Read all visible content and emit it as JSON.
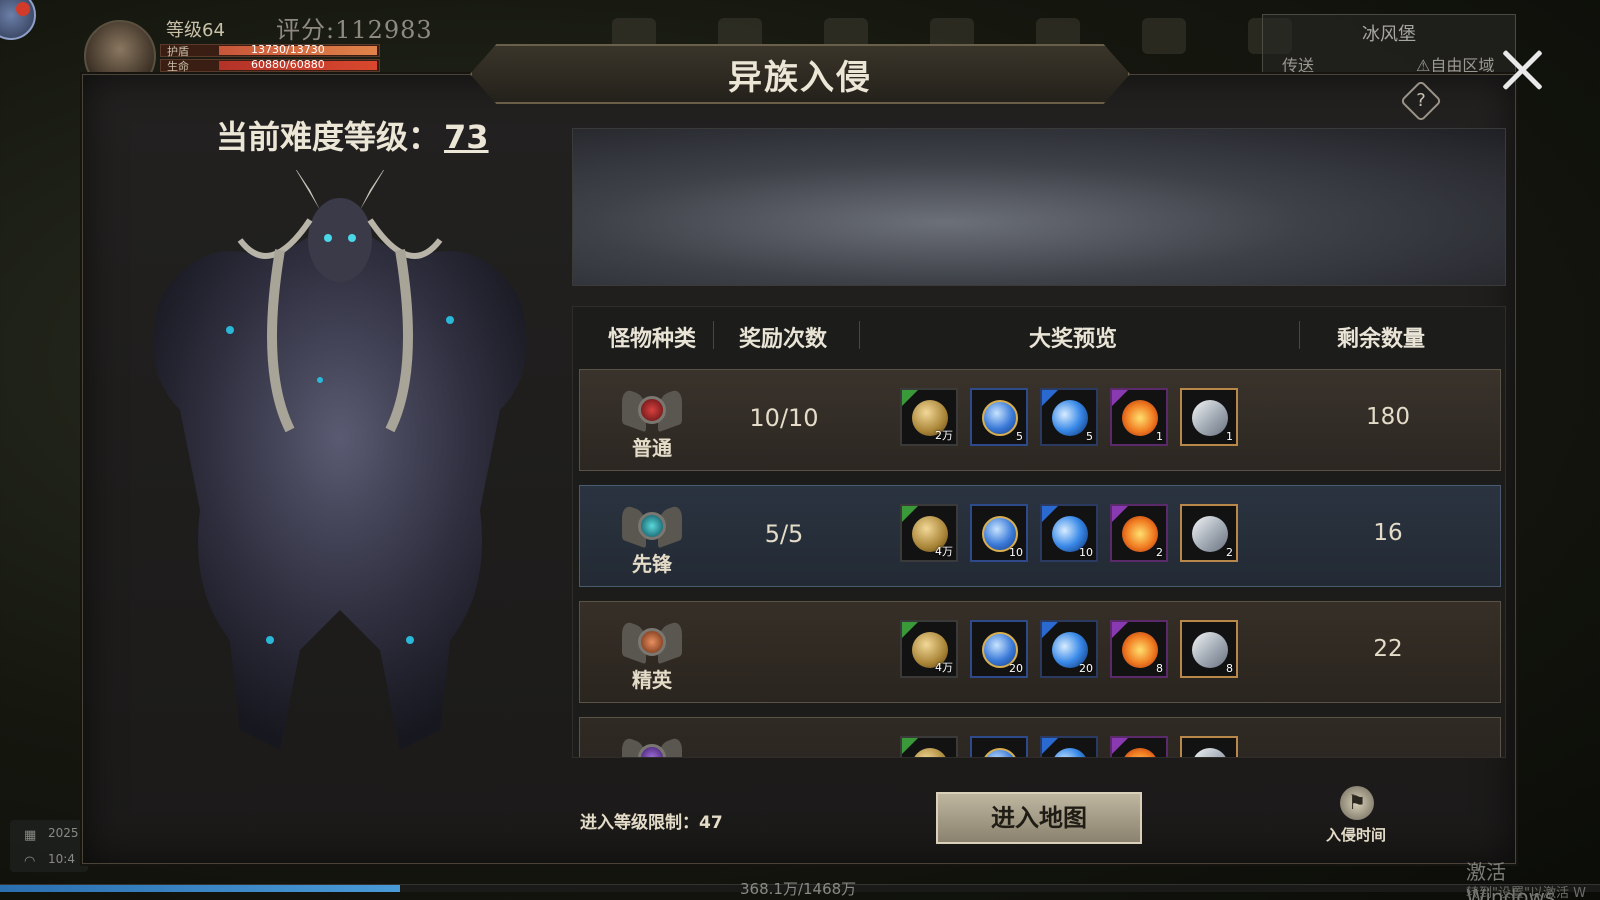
{
  "hud": {
    "level": "等级64",
    "score": "评分:112983",
    "shield_label": "护盾",
    "shield_value": "13730/13730",
    "hp_label": "生命",
    "hp_value": "60880/60880",
    "map_name": "冰风堡",
    "teleport": "传送",
    "zone": "⚠自由区域",
    "date": "2025",
    "time": "10:4",
    "exp_text": "368.1万/1468万",
    "exp_progress": 0.25,
    "windows_watermark": "激活 Windows",
    "windows_watermark_sub": "转到\"设置\"以激活 W"
  },
  "dialog": {
    "title": "异族入侵",
    "help_icon": "?",
    "difficulty_label": "当前难度等级：",
    "difficulty_value": "73",
    "table": {
      "headers": [
        "怪物种类",
        "奖励次数",
        "大奖预览",
        "剩余数量"
      ],
      "rows": [
        {
          "type": "普通",
          "count": "10/10",
          "remaining": "180",
          "items": [
            {
              "icon": "gold-coin",
              "qty": "2万"
            },
            {
              "icon": "blue-orb",
              "qty": "5"
            },
            {
              "icon": "blue-bubbles",
              "qty": "5"
            },
            {
              "icon": "fire-gem",
              "qty": "1"
            },
            {
              "icon": "crystal",
              "qty": "1"
            }
          ]
        },
        {
          "type": "先锋",
          "count": "5/5",
          "remaining": "16",
          "items": [
            {
              "icon": "gold-coin",
              "qty": "4万"
            },
            {
              "icon": "blue-orb",
              "qty": "10"
            },
            {
              "icon": "blue-bubbles",
              "qty": "10"
            },
            {
              "icon": "fire-gem",
              "qty": "2"
            },
            {
              "icon": "crystal",
              "qty": "2"
            }
          ]
        },
        {
          "type": "精英",
          "count": "",
          "remaining": "22",
          "items": [
            {
              "icon": "gold-coin",
              "qty": "4万"
            },
            {
              "icon": "blue-orb",
              "qty": "20"
            },
            {
              "icon": "blue-bubbles",
              "qty": "20"
            },
            {
              "icon": "fire-gem",
              "qty": "8"
            },
            {
              "icon": "crystal",
              "qty": "8"
            }
          ]
        }
      ]
    },
    "level_limit": "进入等级限制：47",
    "enter_button": "进入地图",
    "invade_time": "入侵时间"
  }
}
